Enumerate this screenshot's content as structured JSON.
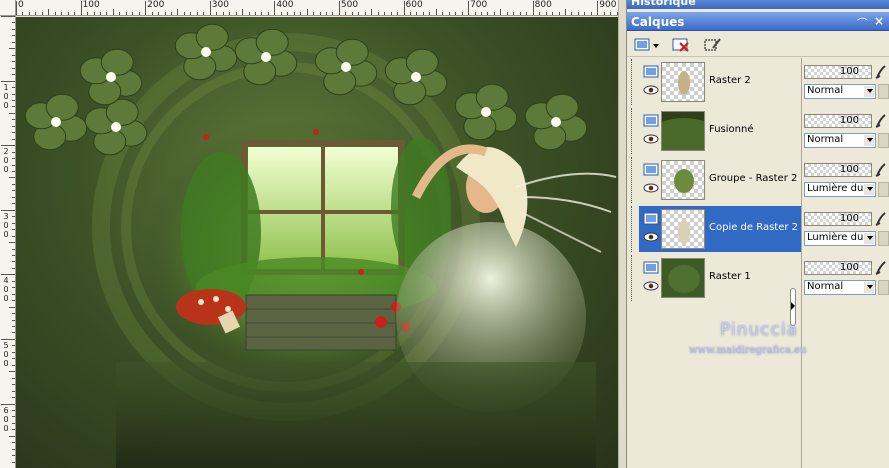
{
  "panels": {
    "history_title": "Historique",
    "layers_title": "Calques",
    "pin_icon": "pin-icon",
    "close_icon": "close-icon"
  },
  "toolbar": {
    "buttons": [
      {
        "name": "new-layer-dropdown-button",
        "icon": "new-layer-icon"
      },
      {
        "name": "delete-layer-button",
        "icon": "delete-layer-icon"
      },
      {
        "name": "edit-selection-button",
        "icon": "selection-brush-icon"
      }
    ]
  },
  "layers": [
    {
      "name": "Raster 2",
      "opacity": "100",
      "blend": "Normal",
      "selected": false,
      "thumb": "figure-thumb"
    },
    {
      "name": "Fusionné",
      "opacity": "100",
      "blend": "Normal",
      "selected": false,
      "thumb": "merged-thumb"
    },
    {
      "name": "Groupe - Raster 2",
      "opacity": "100",
      "blend": "Lumière dure",
      "selected": false,
      "thumb": "group-thumb"
    },
    {
      "name": "Copie de Raster 2",
      "opacity": "100",
      "blend": "Lumière dure",
      "selected": true,
      "thumb": "copy-thumb"
    },
    {
      "name": "Raster 1",
      "opacity": "100",
      "blend": "Normal",
      "selected": false,
      "thumb": "green-thumb"
    }
  ],
  "ruler": {
    "top_labels": [
      "0",
      "100",
      "200",
      "300",
      "400",
      "500",
      "600",
      "700",
      "800",
      "900"
    ],
    "left_labels": [
      "1\n0\n0",
      "2\n0\n0",
      "3\n0\n0",
      "4\n0\n0",
      "5\n0\n0",
      "6\n0\n0"
    ]
  },
  "watermark": {
    "name": "Pinuccia",
    "site": "www.maidiregrafica.eu"
  },
  "colors": {
    "selection": "#316ac5",
    "title_bar": "#3d6bc9",
    "canvas_green": "#3c5226"
  }
}
